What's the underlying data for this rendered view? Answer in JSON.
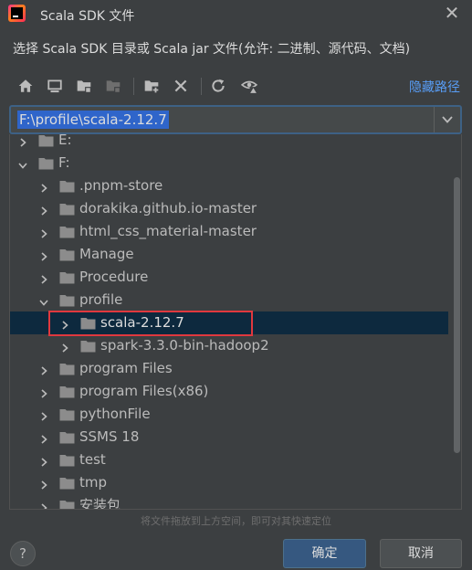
{
  "window": {
    "title": "Scala SDK 文件",
    "description": "选择 Scala SDK 目录或 Scala jar 文件(允许: 二进制、源代码、文档)"
  },
  "toolbar": {
    "icons": [
      "home-icon",
      "desktop-icon",
      "project-folder-icon",
      "module-folder-icon",
      "new-folder-icon",
      "delete-icon",
      "refresh-icon",
      "show-hidden-icon"
    ],
    "hide_path_label": "隐藏路径"
  },
  "path": {
    "value": "F:\\profile\\scala-2.12.7"
  },
  "tree": {
    "rows": [
      {
        "label": "E:",
        "level": 0,
        "expanded": false
      },
      {
        "label": "F:",
        "level": 0,
        "expanded": true
      },
      {
        "label": ".pnpm-store",
        "level": 1,
        "expanded": false
      },
      {
        "label": "dorakika.github.io-master",
        "level": 1,
        "expanded": false
      },
      {
        "label": "html_css_material-master",
        "level": 1,
        "expanded": false
      },
      {
        "label": "Manage",
        "level": 1,
        "expanded": false
      },
      {
        "label": "Procedure",
        "level": 1,
        "expanded": false
      },
      {
        "label": "profile",
        "level": 1,
        "expanded": true
      },
      {
        "label": "scala-2.12.7",
        "level": 2,
        "expanded": false,
        "selected": true
      },
      {
        "label": "spark-3.3.0-bin-hadoop2",
        "level": 2,
        "expanded": false
      },
      {
        "label": "program Files",
        "level": 1,
        "expanded": false
      },
      {
        "label": "program Files(x86)",
        "level": 1,
        "expanded": false
      },
      {
        "label": "pythonFile",
        "level": 1,
        "expanded": false
      },
      {
        "label": "SSMS 18",
        "level": 1,
        "expanded": false
      },
      {
        "label": "test",
        "level": 1,
        "expanded": false
      },
      {
        "label": "tmp",
        "level": 1,
        "expanded": false
      },
      {
        "label": "安装包",
        "level": 1,
        "expanded": false
      }
    ]
  },
  "drop_hint": "将文件拖放到上方空间，即可对其快速定位",
  "buttons": {
    "help": "?",
    "ok": "确定",
    "cancel": "取消"
  },
  "colors": {
    "background": "#3c3f41",
    "selection": "#0d293e",
    "link": "#589df6",
    "primary_button": "#365880",
    "highlight_box": "#e0383e"
  }
}
